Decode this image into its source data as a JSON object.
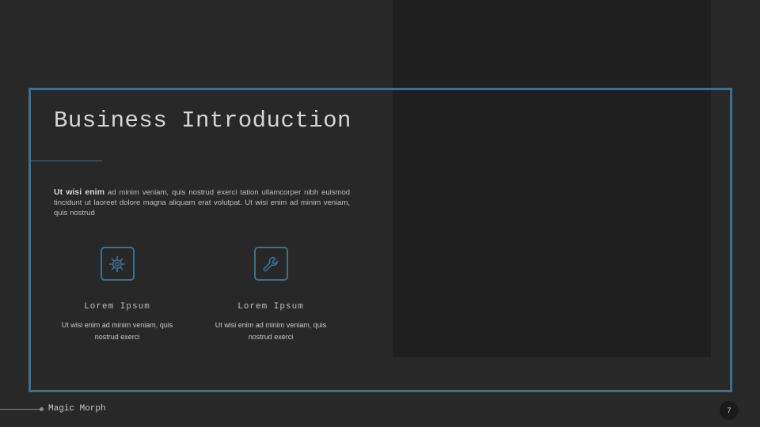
{
  "slide": {
    "title": "Business Introduction",
    "intro": {
      "lead": "Ut wisi enim",
      "text": " ad minim veniam, quis nostrud exerci tation ullamcorper nibh euismod tincidunt ut laoreet dolore magna aliquam erat volutpat. Ut wisi enim ad minim veniam, quis nostrud"
    },
    "features": [
      {
        "icon": "gear-icon",
        "title": "Lorem Ipsum",
        "text": "Ut wisi enim ad minim veniam, quis nostrud exerci"
      },
      {
        "icon": "wrench-icon",
        "title": "Lorem Ipsum",
        "text": "Ut wisi enim ad minim veniam, quis nostrud exerci"
      }
    ]
  },
  "footer": {
    "label": "Magic Morph",
    "page_number": "7"
  },
  "colors": {
    "background": "#282828",
    "accent": "#3e6f8e",
    "image_panel": "#1f1f1f"
  }
}
